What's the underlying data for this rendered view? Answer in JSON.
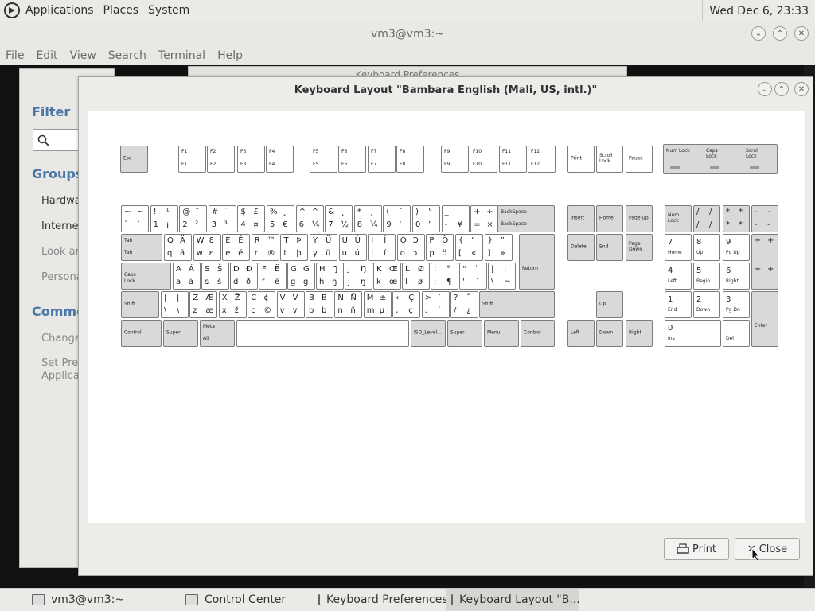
{
  "topbar": {
    "menus": [
      "Applications",
      "Places",
      "System"
    ],
    "clock": "Wed Dec  6, 23:33"
  },
  "terminal": {
    "title": "vm3@vm3:~",
    "menus": [
      "File",
      "Edit",
      "View",
      "Search",
      "Terminal",
      "Help"
    ]
  },
  "kp_title": "Keyboard Preferences",
  "control_center": {
    "filter": "Filter",
    "groups": "Groups",
    "items": [
      "Hardwa",
      "Internet",
      "Look an",
      "Persona"
    ],
    "common": "Commo",
    "common_items": [
      "Change",
      "Set Pref",
      "Applicat"
    ]
  },
  "dialog": {
    "title": "Keyboard Layout \"Bambara English (Mali, US, intl.)\"",
    "print": "Print",
    "close": "Close"
  },
  "taskbar": {
    "tasks": [
      "vm3@vm3:~",
      "Control Center",
      "Keyboard Preferences",
      "Keyboard Layout \"B..."
    ]
  },
  "keyboard": {
    "esc": "Esc",
    "frow": [
      [
        "F1",
        "F1"
      ],
      [
        "F2",
        "F2"
      ],
      [
        "F3",
        "F3"
      ],
      [
        "F4",
        "F4"
      ],
      [
        "F5",
        "F5"
      ],
      [
        "F6",
        "F6"
      ],
      [
        "F7",
        "F7"
      ],
      [
        "F8",
        "F8"
      ],
      [
        "F9",
        "F9"
      ],
      [
        "F10",
        "F10"
      ],
      [
        "F11",
        "F11"
      ],
      [
        "F12",
        "F12"
      ]
    ],
    "sys": [
      "Print",
      "Scroll Lock",
      "Pause"
    ],
    "locks": [
      "Num Lock",
      "Caps Lock",
      "Scroll Lock"
    ],
    "row1": [
      [
        "~",
        "~",
        "`",
        "`"
      ],
      [
        "!",
        "¹",
        "1",
        "¡"
      ],
      [
        "@",
        "˝",
        "2",
        "²"
      ],
      [
        "#",
        "¯",
        "3",
        "³"
      ],
      [
        "$",
        "£",
        "4",
        "¤"
      ],
      [
        "%",
        "¸",
        "5",
        "€"
      ],
      [
        "^",
        "^",
        "6",
        "¼"
      ],
      [
        "&",
        "˛",
        "7",
        "½"
      ],
      [
        "*",
        "˛",
        "8",
        "¾"
      ],
      [
        "(",
        "˘",
        "9",
        "‘"
      ],
      [
        ")",
        "°",
        "0",
        "’"
      ],
      [
        "_",
        "",
        "-",
        "¥"
      ],
      [
        "+",
        "÷",
        "=",
        "×"
      ]
    ],
    "backspace": [
      "BackSpace",
      "BackSpace"
    ],
    "tab": [
      "Tab",
      "Tab"
    ],
    "row2": [
      [
        "Q",
        "Ä",
        "q",
        "ä"
      ],
      [
        "W",
        "Ɛ",
        "w",
        "ɛ"
      ],
      [
        "E",
        "É",
        "e",
        "é"
      ],
      [
        "R",
        "™",
        "r",
        "®"
      ],
      [
        "T",
        "Þ",
        "t",
        "þ"
      ],
      [
        "Y",
        "Ü",
        "y",
        "ü"
      ],
      [
        "U",
        "Ú",
        "u",
        "ú"
      ],
      [
        "I",
        "Í",
        "i",
        "í"
      ],
      [
        "O",
        "Ɔ",
        "o",
        "ɔ"
      ],
      [
        "P",
        "Ö",
        "p",
        "ö"
      ],
      [
        "{",
        "“",
        "[",
        "«"
      ],
      [
        "}",
        "”",
        "]",
        "»"
      ]
    ],
    "caps": [
      "Caps",
      "Lock"
    ],
    "row3": [
      [
        "A",
        "Á",
        "a",
        "á"
      ],
      [
        "S",
        "Š",
        "s",
        "š"
      ],
      [
        "D",
        "Ð",
        "d",
        "ð"
      ],
      [
        "F",
        "Ë",
        "f",
        "ë"
      ],
      [
        "G",
        "G",
        "g",
        "g"
      ],
      [
        "H",
        "Ŋ",
        "h",
        "ŋ"
      ],
      [
        "J",
        "Ŋ",
        "j",
        "ŋ"
      ],
      [
        "K",
        "Œ",
        "k",
        "œ"
      ],
      [
        "L",
        "Ø",
        "l",
        "ø"
      ],
      [
        ":",
        "°",
        ";",
        "¶"
      ],
      [
        "\"",
        "¨",
        "'",
        "´"
      ],
      [
        "|",
        "¦",
        "\\",
        "¬"
      ]
    ],
    "return": "Return",
    "shift": "Shift",
    "row4": [
      [
        "|",
        "|",
        "\\",
        "\\"
      ],
      [
        "Z",
        "Æ",
        "z",
        "æ"
      ],
      [
        "X",
        "Ž",
        "x",
        "ž"
      ],
      [
        "C",
        "¢",
        "c",
        "©"
      ],
      [
        "V",
        "V",
        "v",
        "v"
      ],
      [
        "B",
        "B",
        "b",
        "b"
      ],
      [
        "N",
        "Ñ",
        "n",
        "ñ"
      ],
      [
        "M",
        "±",
        "m",
        "µ"
      ],
      [
        "‹",
        "Ç",
        ",",
        "ç"
      ],
      [
        ">",
        "ˇ",
        ".",
        "˙"
      ],
      [
        "?",
        "˚",
        "/",
        "¿"
      ]
    ],
    "row5": {
      "control": "Control",
      "super": "Super",
      "alt_top": "Meta",
      "alt": "Alt",
      "iso": "ISO_Level...",
      "menu": "Menu"
    },
    "nav": {
      "insert": "Insert",
      "home": "Home",
      "pgup": "Page Up",
      "delete": "Delete",
      "end": "End",
      "pgdn": "Page Down",
      "up": "Up",
      "left": "Left",
      "down": "Down",
      "right": "Right"
    },
    "numpad": {
      "numlock": "Num Lock",
      "slash": [
        "/",
        "/",
        "/",
        "/"
      ],
      "star": [
        "*",
        "*",
        "*",
        "*"
      ],
      "minus": [
        "-",
        "-",
        "-",
        "-"
      ],
      "plus": [
        "+",
        "+",
        "+",
        "+"
      ],
      "k7": [
        "7",
        "Home"
      ],
      "k8": [
        "8",
        "Up"
      ],
      "k9": [
        "9",
        "Pg Up"
      ],
      "k4": [
        "4",
        "Left"
      ],
      "k5": [
        "5",
        "Begin"
      ],
      "k6": [
        "6",
        "Right"
      ],
      "k1": [
        "1",
        "End"
      ],
      "k2": [
        "2",
        "Down"
      ],
      "k3": [
        "3",
        "Pg Dn"
      ],
      "k0": [
        "0",
        "Ins"
      ],
      "kdot": [
        ".",
        "Del"
      ],
      "enter": "Enter"
    }
  }
}
